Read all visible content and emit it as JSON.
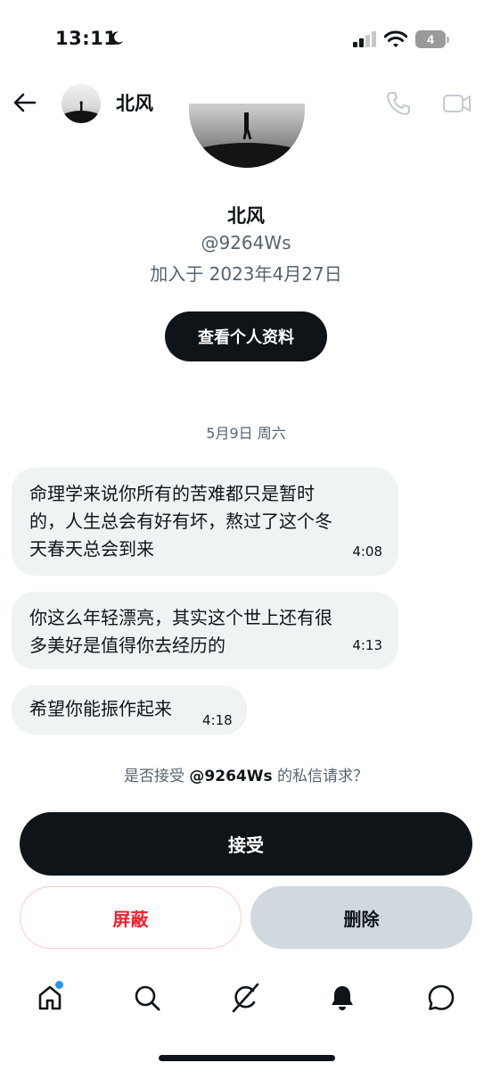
{
  "status_bar": {
    "time": "13:11",
    "battery": "4"
  },
  "header": {
    "name": "北风"
  },
  "profile": {
    "name": "北风",
    "handle": "@9264Ws",
    "joined": "加入于 2023年4月27日",
    "view_profile_label": "查看个人资料"
  },
  "conversation": {
    "date": "5月9日 周六",
    "messages": [
      {
        "lines": [
          "命理学来说你所有的苦难都只是暂时",
          "的，人生总会有好有坏，熬过了这个冬",
          "天春天总会到来"
        ],
        "time": "4:08"
      },
      {
        "lines": [
          "你这么年轻漂亮，其实这个世上还有很",
          "多美好是值得你去经历的"
        ],
        "time": "4:13"
      },
      {
        "lines": [
          "希望你能振作起来"
        ],
        "time": "4:18"
      }
    ]
  },
  "request": {
    "prefix": "是否接受 ",
    "handle": "@9264Ws",
    "suffix": " 的私信请求？"
  },
  "actions": {
    "accept": "接受",
    "block": "屏蔽",
    "delete": "删除"
  },
  "bottom_nav": [
    "home-icon",
    "search-icon",
    "grok-icon",
    "notifications-icon",
    "messages-icon"
  ],
  "colors": {
    "accent": "#1d9bf0",
    "danger": "#f4212e",
    "text": "#0f1419",
    "secondary": "#536471",
    "bubble": "#eff3f4"
  }
}
